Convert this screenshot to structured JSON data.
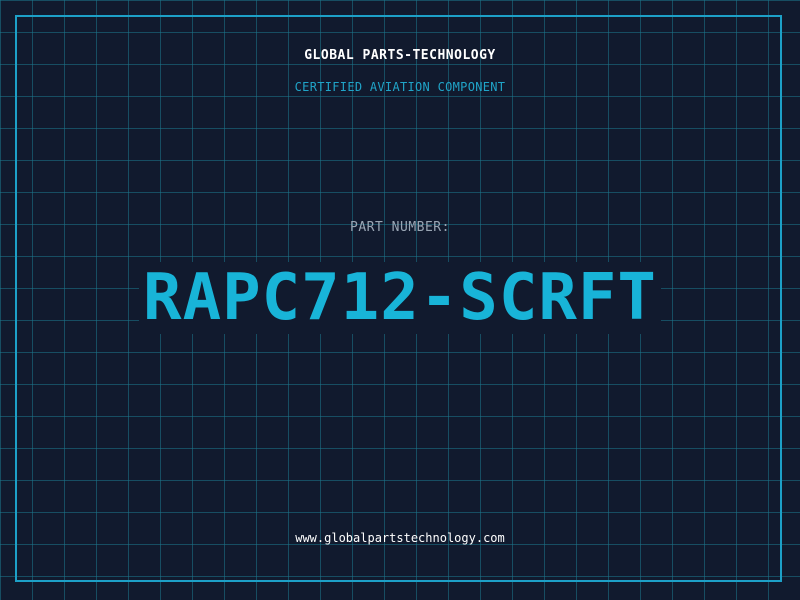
{
  "header": {
    "company": "GLOBAL PARTS-TECHNOLOGY",
    "subtitle": "CERTIFIED AVIATION COMPONENT"
  },
  "main": {
    "part_label": "PART NUMBER:",
    "part_number": "RAPC712-SCRFT"
  },
  "footer": {
    "website": "www.globalpartstechnology.com"
  },
  "colors": {
    "background": "#111a2e",
    "grid": "#1b768c",
    "accent": "#18b4d8",
    "frame": "#1da0c8",
    "text_primary": "#ffffff",
    "text_muted": "#9aa6b4"
  }
}
